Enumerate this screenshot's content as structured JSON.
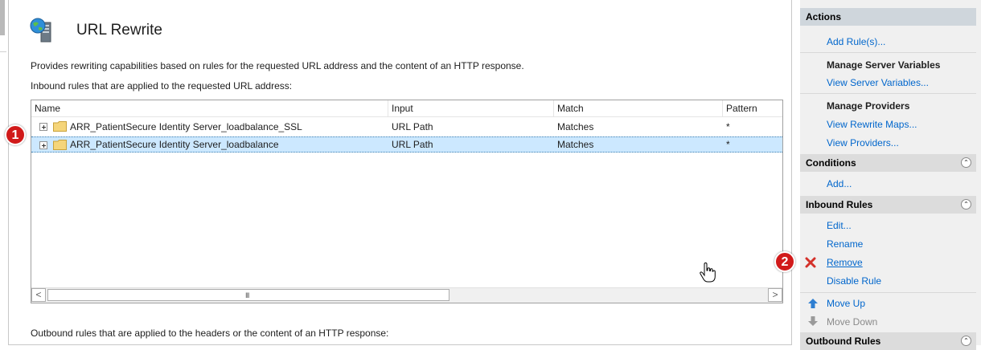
{
  "page": {
    "title": "URL Rewrite",
    "description": "Provides rewriting capabilities based on rules for the requested URL address and the content of an HTTP response.",
    "inbound_caption": "Inbound rules that are applied to the requested URL address:",
    "outbound_caption": "Outbound rules that are applied to the headers or the content of an HTTP response:"
  },
  "grid": {
    "columns": [
      "Name",
      "Input",
      "Match",
      "Pattern"
    ],
    "rows": [
      {
        "name": "ARR_PatientSecure Identity Server_loadbalance_SSL",
        "input": "URL Path",
        "match": "Matches",
        "pattern": "*"
      },
      {
        "name": "ARR_PatientSecure Identity Server_loadbalance",
        "input": "URL Path",
        "match": "Matches",
        "pattern": "*"
      }
    ],
    "scroll_left": "<",
    "scroll_right": ">",
    "scroll_grip": "III"
  },
  "badges": {
    "one": "1",
    "two": "2"
  },
  "actions": {
    "header": "Actions",
    "add_rules": "Add Rule(s)...",
    "manage_server_variables": "Manage Server Variables",
    "view_server_variables": "View Server Variables...",
    "manage_providers": "Manage Providers",
    "view_rewrite_maps": "View Rewrite Maps...",
    "view_providers": "View Providers...",
    "conditions_header": "Conditions",
    "conditions_add": "Add...",
    "inbound_header": "Inbound Rules",
    "edit": "Edit...",
    "rename": "Rename",
    "remove": "Remove",
    "disable_rule": "Disable Rule",
    "move_up": "Move Up",
    "move_down": "Move Down",
    "outbound_header": "Outbound Rules"
  },
  "colors": {
    "link": "#0066cc",
    "badge": "#d11a1a",
    "selection": "#cce8ff",
    "remove_icon": "#d4312a",
    "move_up_icon": "#2f7fd1"
  }
}
